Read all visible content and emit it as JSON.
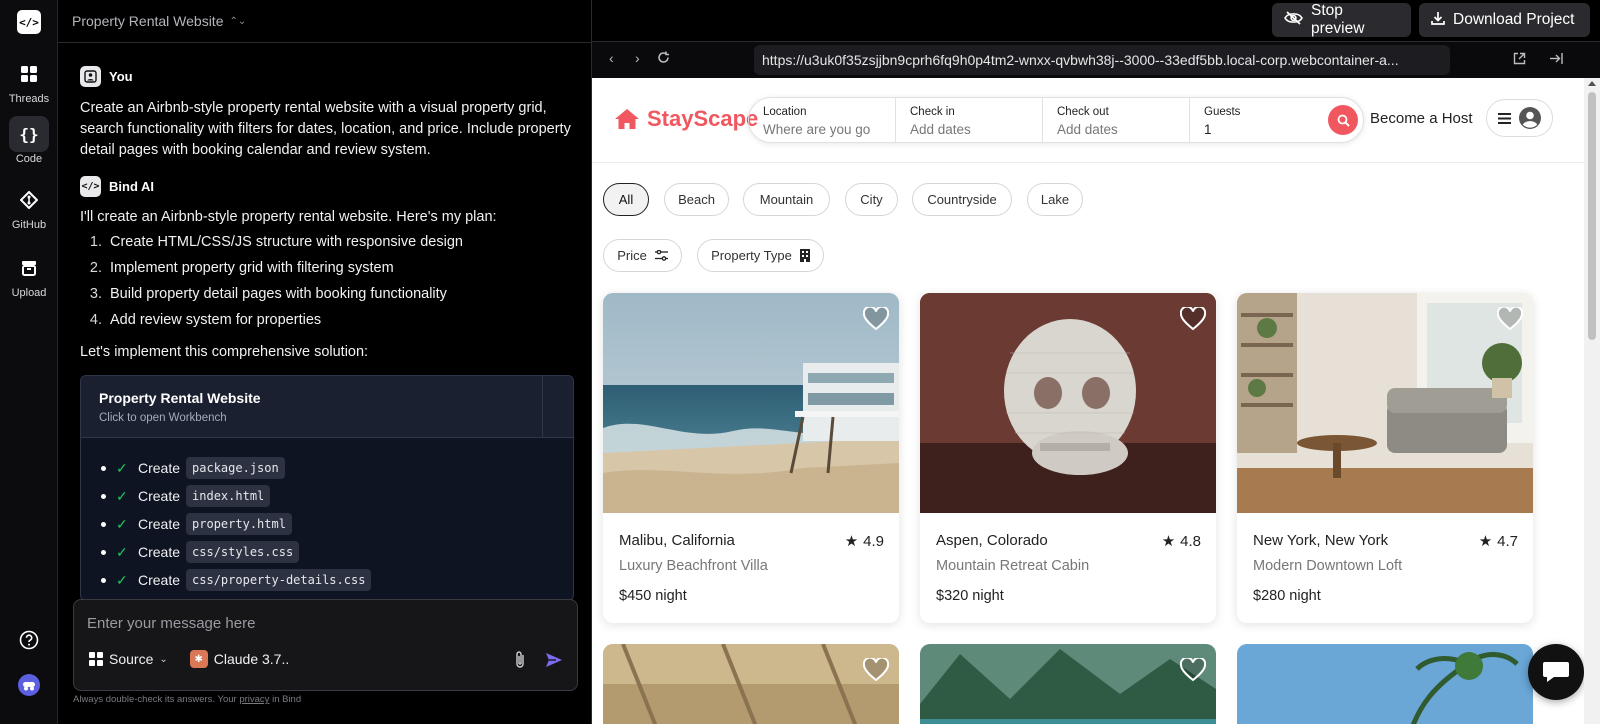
{
  "rail": {
    "logo": "</>",
    "items": [
      {
        "label": "Threads",
        "icon": "grid-icon"
      },
      {
        "label": "Code",
        "icon": "braces-icon"
      },
      {
        "label": "GitHub",
        "icon": "github-icon"
      },
      {
        "label": "Upload",
        "icon": "upload-icon"
      }
    ],
    "help_icon": "help-icon",
    "avatar_icon": "avatar-icon"
  },
  "chat": {
    "project_title": "Property Rental Website",
    "user_name": "You",
    "user_message": "Create an Airbnb-style property rental website with a visual property grid, search functionality with filters for dates, location, and price. Include property detail pages with booking calendar and review system.",
    "ai_name": "Bind AI",
    "ai_intro": "I'll create an Airbnb-style property rental website. Here's my plan:",
    "plan": [
      "Create HTML/CSS/JS structure with responsive design",
      "Implement property grid with filtering system",
      "Build property detail pages with booking functionality",
      "Add review system for properties"
    ],
    "ai_outro": "Let's implement this comprehensive solution:",
    "workbench": {
      "title": "Property Rental Website",
      "subtitle": "Click to open Workbench",
      "steps": [
        {
          "label": "Create",
          "file": "package.json"
        },
        {
          "label": "Create",
          "file": "index.html"
        },
        {
          "label": "Create",
          "file": "property.html"
        },
        {
          "label": "Create",
          "file": "css/styles.css"
        },
        {
          "label": "Create",
          "file": "css/property-details.css"
        }
      ]
    },
    "composer": {
      "placeholder": "Enter your message here",
      "source_label": "Source",
      "model_label": "Claude 3.7.."
    },
    "disclaimer_pre": "Always double-check its answers. Your ",
    "disclaimer_link": "privacy",
    "disclaimer_post": " in Bind"
  },
  "preview": {
    "stop_label": "Stop preview",
    "download_label": "Download Project",
    "url": "https://u3uk0f35zsjjbn9cprh6fq9h0p4tm2-wnxx-qvbwh38j--3000--33edf5bb.local-corp.webcontainer-a..."
  },
  "site": {
    "brand": "StayScape",
    "search": {
      "location_label": "Location",
      "location_placeholder": "Where are you going?",
      "checkin_label": "Check in",
      "checkin_placeholder": "Add dates",
      "checkout_label": "Check out",
      "checkout_placeholder": "Add dates",
      "guests_label": "Guests",
      "guests_value": "1"
    },
    "host_label": "Become a Host",
    "categories": [
      "All",
      "Beach",
      "Mountain",
      "City",
      "Countryside",
      "Lake"
    ],
    "filters": [
      "Price",
      "Property Type"
    ],
    "properties": [
      {
        "location": "Malibu, California",
        "rating": "4.9",
        "name": "Luxury Beachfront Villa",
        "price": "$450",
        "unit": "night"
      },
      {
        "location": "Aspen, Colorado",
        "rating": "4.8",
        "name": "Mountain Retreat Cabin",
        "price": "$320",
        "unit": "night"
      },
      {
        "location": "New York, New York",
        "rating": "4.7",
        "name": "Modern Downtown Loft",
        "price": "$280",
        "unit": "night"
      }
    ]
  },
  "colors": {
    "brand": "#f0575f",
    "accent_send": "#7c6cf2",
    "check": "#22c55e"
  }
}
